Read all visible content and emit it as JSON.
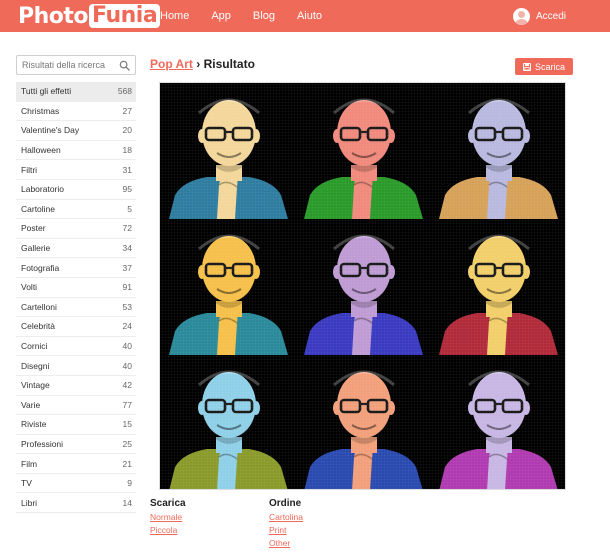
{
  "header": {
    "logo_photo": "Photo",
    "logo_funia": "Funia",
    "nav": [
      "Home",
      "App",
      "Blog",
      "Aiuto"
    ],
    "login_label": "Accedi"
  },
  "sidebar": {
    "search_placeholder": "Risultati della ricerca",
    "categories": [
      {
        "label": "Tutti gli effetti",
        "count": "568"
      },
      {
        "label": "Christmas",
        "count": "27"
      },
      {
        "label": "Valentine's Day",
        "count": "20"
      },
      {
        "label": "Halloween",
        "count": "18"
      },
      {
        "label": "Filtri",
        "count": "31"
      },
      {
        "label": "Laboratorio",
        "count": "95"
      },
      {
        "label": "Cartoline",
        "count": "5"
      },
      {
        "label": "Poster",
        "count": "72"
      },
      {
        "label": "Gallerie",
        "count": "34"
      },
      {
        "label": "Fotografia",
        "count": "37"
      },
      {
        "label": "Volti",
        "count": "91"
      },
      {
        "label": "Cartelloni",
        "count": "53"
      },
      {
        "label": "Celebrità",
        "count": "24"
      },
      {
        "label": "Cornici",
        "count": "40"
      },
      {
        "label": "Disegni",
        "count": "40"
      },
      {
        "label": "Vintage",
        "count": "42"
      },
      {
        "label": "Varie",
        "count": "77"
      },
      {
        "label": "Riviste",
        "count": "15"
      },
      {
        "label": "Professioni",
        "count": "25"
      },
      {
        "label": "Film",
        "count": "21"
      },
      {
        "label": "TV",
        "count": "9"
      },
      {
        "label": "Libri",
        "count": "14"
      }
    ]
  },
  "main": {
    "breadcrumb_link": "Pop Art",
    "breadcrumb_sep": " › ",
    "breadcrumb_current": "Risultato",
    "download_label": "Scarica",
    "tiles": [
      {
        "face": "#f3d79a",
        "shirt": "#2e7da0",
        "glasses": "#1a1a1a"
      },
      {
        "face": "#f08a7c",
        "shirt": "#2a9a2a",
        "glasses": "#1a1a1a"
      },
      {
        "face": "#b9b9e0",
        "shirt": "#d6a25a",
        "glasses": "#1a1a1a"
      },
      {
        "face": "#f6c04a",
        "shirt": "#2a8a9a",
        "glasses": "#1a1a1a"
      },
      {
        "face": "#bf9bd4",
        "shirt": "#3a3ac0",
        "glasses": "#1a1a1a"
      },
      {
        "face": "#f2cf6a",
        "shirt": "#b02a3a",
        "glasses": "#1a1a1a"
      },
      {
        "face": "#8fd0e8",
        "shirt": "#8a9a2a",
        "glasses": "#1a1a1a"
      },
      {
        "face": "#f2a07a",
        "shirt": "#2a4ab0",
        "glasses": "#1a1a1a"
      },
      {
        "face": "#c8b6e4",
        "shirt": "#b03ab0",
        "glasses": "#1a1a1a"
      }
    ]
  },
  "footer": {
    "download_title": "Scarica",
    "download_links": [
      "Normale",
      "Piccola"
    ],
    "order_title": "Ordine",
    "order_links": [
      "Cartolina",
      "Print",
      "Other"
    ]
  },
  "colors": {
    "accent": "#f06a5a"
  }
}
